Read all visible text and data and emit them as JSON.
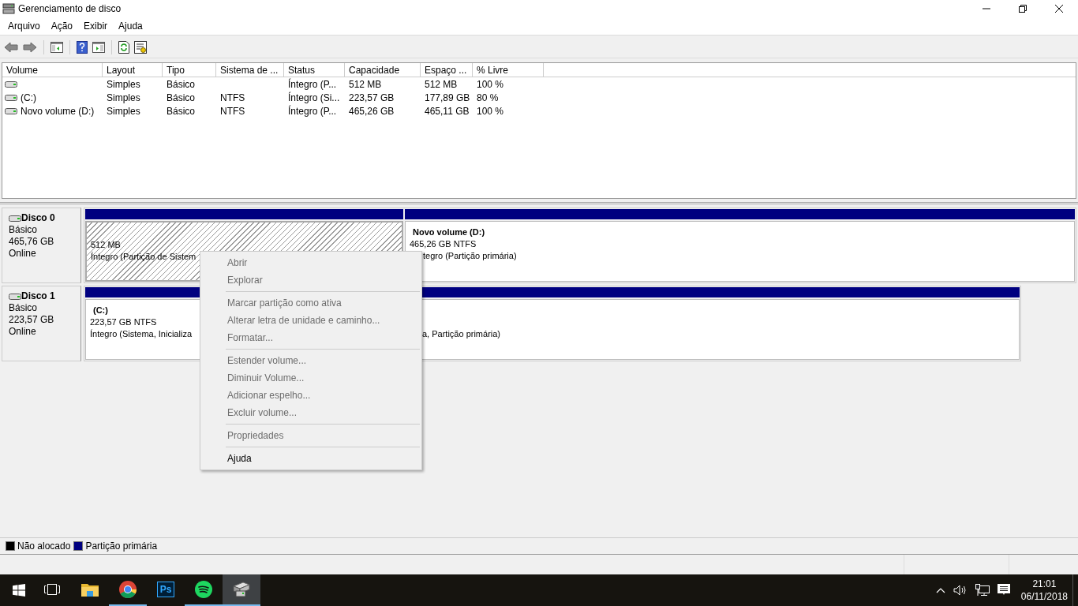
{
  "window": {
    "title": "Gerenciamento de disco"
  },
  "menu": [
    "Arquivo",
    "Ação",
    "Exibir",
    "Ajuda"
  ],
  "toolbar": [
    {
      "kind": "back"
    },
    {
      "kind": "forward"
    },
    {
      "kind": "separator"
    },
    {
      "kind": "console-tree"
    },
    {
      "kind": "separator"
    },
    {
      "kind": "help"
    },
    {
      "kind": "action-pane"
    },
    {
      "kind": "separator"
    },
    {
      "kind": "refresh"
    },
    {
      "kind": "properties"
    }
  ],
  "table": {
    "columns": [
      "Volume",
      "Layout",
      "Tipo",
      "Sistema de ...",
      "Status",
      "Capacidade",
      "Espaço ...",
      "% Livre"
    ],
    "rows": [
      {
        "layout": "Simples",
        "tipo": "Básico",
        "status": "Íntegro (P...",
        "capacidade": "512 MB",
        "espaco": "512 MB",
        "livre": "100 %"
      },
      {
        "volume": "(C:)",
        "layout": "Simples",
        "tipo": "Básico",
        "sistema": "NTFS",
        "status": "Íntegro (Si...",
        "capacidade": "223,57 GB",
        "espaco": "177,89 GB",
        "livre": "80 %"
      },
      {
        "volume": "Novo volume (D:)",
        "layout": "Simples",
        "tipo": "Básico",
        "sistema": "NTFS",
        "status": "Íntegro (P...",
        "capacidade": "465,26 GB",
        "espaco": "465,11 GB",
        "livre": "100 %"
      }
    ]
  },
  "disks": [
    {
      "name": "Disco 0",
      "type": "Básico",
      "size": "465,76 GB",
      "state": "Online",
      "partitions": [
        {
          "size": "512 MB",
          "status": "Íntegro (Partição de Sistem",
          "selected": true,
          "color": "#000080"
        },
        {
          "label": "Novo volume  (D:)",
          "size": "465,26 GB NTFS",
          "status_right": "tegro (Partição primária)",
          "selected": false,
          "color": "#000080"
        }
      ]
    },
    {
      "name": "Disco 1",
      "type": "Básico",
      "size": "223,57 GB",
      "state": "Online",
      "partitions": [
        {
          "label": "(C:)",
          "size": "223,57 GB NTFS",
          "status": "Íntegro (Sistema, Inicializa",
          "status_right": "a, Partição primária)",
          "selected": false,
          "color": "#000080"
        }
      ]
    }
  ],
  "legend": [
    {
      "label": "Não alocado",
      "color": "#000000"
    },
    {
      "label": "Partição primária",
      "color": "#000080"
    }
  ],
  "context_menu": [
    {
      "kind": "item",
      "label": "Abrir",
      "disabled": true
    },
    {
      "kind": "item",
      "label": "Explorar",
      "disabled": true
    },
    {
      "kind": "separator"
    },
    {
      "kind": "item",
      "label": "Marcar partição como ativa",
      "disabled": true
    },
    {
      "kind": "item",
      "label": "Alterar letra de unidade e caminho...",
      "disabled": true
    },
    {
      "kind": "item",
      "label": "Formatar...",
      "disabled": true
    },
    {
      "kind": "separator"
    },
    {
      "kind": "item",
      "label": "Estender volume...",
      "disabled": true
    },
    {
      "kind": "item",
      "label": "Diminuir Volume...",
      "disabled": true
    },
    {
      "kind": "item",
      "label": "Adicionar espelho...",
      "disabled": true
    },
    {
      "kind": "item",
      "label": "Excluir volume...",
      "disabled": true
    },
    {
      "kind": "separator"
    },
    {
      "kind": "item",
      "label": "Propriedades",
      "disabled": true
    },
    {
      "kind": "separator"
    },
    {
      "kind": "item",
      "label": "Ajuda",
      "disabled": false
    }
  ],
  "taskbar": {
    "apps": [
      {
        "kind": "task-view",
        "running": false,
        "selected": false
      },
      {
        "kind": "folder",
        "running": false,
        "selected": false
      },
      {
        "kind": "chrome",
        "running": true,
        "selected": false
      },
      {
        "kind": "ps",
        "label": "Ps",
        "running": false,
        "selected": false
      },
      {
        "kind": "spotify",
        "running": true,
        "selected": false
      },
      {
        "kind": "disk",
        "running": true,
        "selected": true
      }
    ],
    "time": "21:01",
    "date": "06/11/2018"
  }
}
